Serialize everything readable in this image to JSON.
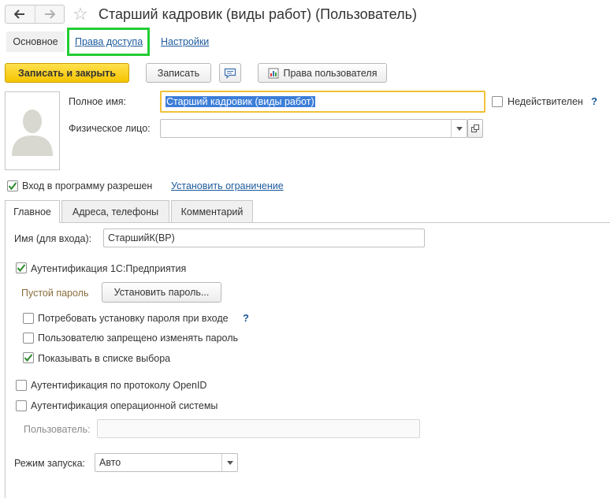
{
  "window": {
    "title": "Старший кадровик (виды работ) (Пользователь)"
  },
  "sections": {
    "main": "Основное",
    "access": "Права доступа",
    "settings": "Настройки"
  },
  "toolbar": {
    "save_close": "Записать и закрыть",
    "save": "Записать",
    "user_rights": "Права пользователя"
  },
  "form": {
    "full_name_label": "Полное имя:",
    "full_name_value": "Старший кадровик (виды работ)",
    "invalid_label": "Недействителен",
    "person_label": "Физическое лицо:",
    "person_value": "",
    "login_allowed_label": "Вход в программу разрешен",
    "set_restriction_link": "Установить ограничение"
  },
  "tabs": [
    "Главное",
    "Адреса, телефоны",
    "Комментарий"
  ],
  "main_tab": {
    "login_name_label": "Имя (для входа):",
    "login_name_value": "СтаршийК(ВР)",
    "auth_1c_label": "Аутентификация 1С:Предприятия",
    "empty_password_label": "Пустой пароль",
    "set_password_button": "Установить пароль...",
    "require_password_label": "Потребовать установку пароля при входе",
    "help_mark": "?",
    "forbid_change_label": "Пользователю запрещено изменять пароль",
    "show_in_list_label": "Показывать в списке выбора",
    "openid_label": "Аутентификация по протоколу OpenID",
    "os_auth_label": "Аутентификация операционной системы",
    "os_user_label": "Пользователь:",
    "os_user_value": "",
    "launch_mode_label": "Режим запуска:",
    "launch_mode_value": "Авто"
  },
  "colors": {
    "accent_yellow": "#f5c400",
    "link": "#1d5a9c",
    "highlight": "#22cc33",
    "focus": "#f0c238"
  }
}
